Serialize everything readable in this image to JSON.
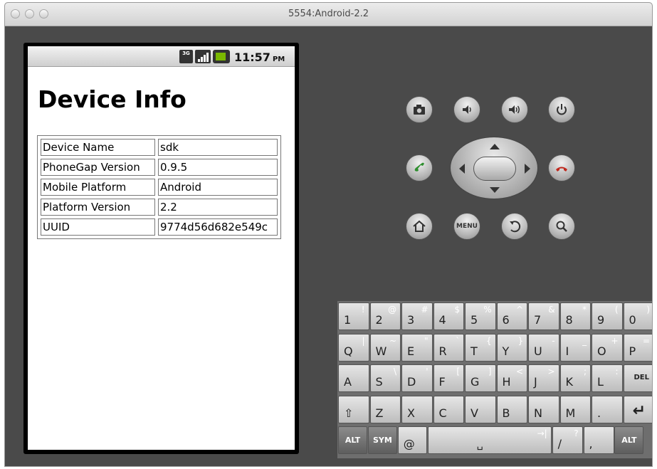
{
  "window": {
    "title": "5554:Android-2.2"
  },
  "statusbar": {
    "network": "3G",
    "time": "11:57",
    "ampm": "PM",
    "battery_color": "#7ab800"
  },
  "page": {
    "title": "Device Info"
  },
  "device_info": [
    {
      "key": "Device Name",
      "value": "sdk"
    },
    {
      "key": "PhoneGap Version",
      "value": "0.9.5"
    },
    {
      "key": "Mobile Platform",
      "value": "Android"
    },
    {
      "key": "Platform Version",
      "value": "2.2"
    },
    {
      "key": "UUID",
      "value": "9774d56d682e549c"
    }
  ],
  "controls": {
    "camera": "camera-icon",
    "vol_down": "volume-down-icon",
    "vol_up": "volume-up-icon",
    "power": "power-icon",
    "call": "call-icon",
    "end_call": "end-call-icon",
    "home": "home-icon",
    "menu": "MENU",
    "back": "back-icon",
    "search": "search-icon"
  },
  "keyboard": {
    "row1": [
      {
        "k": "1",
        "a": "!"
      },
      {
        "k": "2",
        "a": "@"
      },
      {
        "k": "3",
        "a": "#"
      },
      {
        "k": "4",
        "a": "$"
      },
      {
        "k": "5",
        "a": "%"
      },
      {
        "k": "6",
        "a": "^"
      },
      {
        "k": "7",
        "a": "&"
      },
      {
        "k": "8",
        "a": "*"
      },
      {
        "k": "9",
        "a": "("
      },
      {
        "k": "0",
        "a": ")"
      }
    ],
    "row2": [
      {
        "k": "Q",
        "a": "|"
      },
      {
        "k": "W",
        "a": "~"
      },
      {
        "k": "E",
        "a": "\""
      },
      {
        "k": "R",
        "a": "`"
      },
      {
        "k": "T",
        "a": "{"
      },
      {
        "k": "Y",
        "a": "}"
      },
      {
        "k": "U",
        "a": "-"
      },
      {
        "k": "I",
        "a": "_"
      },
      {
        "k": "O",
        "a": "+"
      },
      {
        "k": "P",
        "a": "="
      }
    ],
    "row3": [
      {
        "k": "A",
        "a": ""
      },
      {
        "k": "S",
        "a": "\\"
      },
      {
        "k": "D",
        "a": "'"
      },
      {
        "k": "F",
        "a": "["
      },
      {
        "k": "G",
        "a": "]"
      },
      {
        "k": "H",
        "a": "<"
      },
      {
        "k": "J",
        "a": ">"
      },
      {
        "k": "K",
        "a": ";"
      },
      {
        "k": "L",
        "a": ":"
      },
      {
        "k": "DEL",
        "a": ""
      }
    ],
    "row4": [
      {
        "k": "⇧",
        "a": ""
      },
      {
        "k": "Z",
        "a": ""
      },
      {
        "k": "X",
        "a": ""
      },
      {
        "k": "C",
        "a": ""
      },
      {
        "k": "V",
        "a": ""
      },
      {
        "k": "B",
        "a": ""
      },
      {
        "k": "N",
        "a": ""
      },
      {
        "k": "M",
        "a": ""
      },
      {
        "k": ".",
        "a": ""
      },
      {
        "k": "↵",
        "a": ""
      }
    ],
    "row5": [
      {
        "k": "ALT",
        "a": ""
      },
      {
        "k": "SYM",
        "a": ""
      },
      {
        "k": "@",
        "a": ""
      },
      {
        "k": "␣",
        "a": "→|"
      },
      {
        "k": "/",
        "a": "?"
      },
      {
        "k": ",",
        "a": ""
      },
      {
        "k": "ALT",
        "a": ""
      }
    ]
  }
}
